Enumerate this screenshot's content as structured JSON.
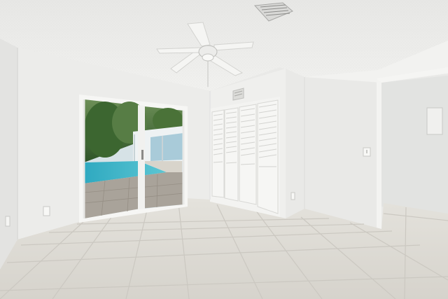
{
  "scene": {
    "description_free": true,
    "palette": {
      "ceiling": "#efefed",
      "wall_left": "#ebebea",
      "wall_back": "#eeeeec",
      "wall_right": "#e6e6e4",
      "floor": "#dedcd6",
      "grout": "#c9c6bf",
      "pool_water": "#3fb6c8",
      "foliage": "#3f6b35",
      "sky": "#d9e6ea",
      "closet_door": "#f4f4f2",
      "louver_shadow": "#d3d3d0",
      "frame": "#f7f7f5"
    },
    "icons": [
      "ceiling-fan-icon",
      "air-vent-icon",
      "light-switch-icon",
      "outlet-icon"
    ]
  }
}
